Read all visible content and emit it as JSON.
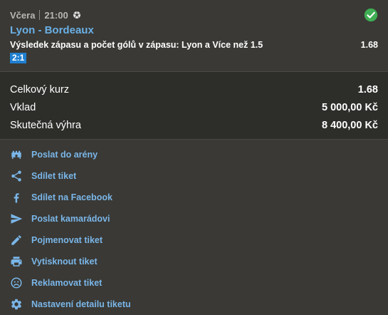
{
  "bet": {
    "day": "Včera",
    "time": "21:00",
    "match": "Lyon - Bordeaux",
    "selection": "Výsledek zápasu a počet gólů v zápasu: Lyon a Více než 1.5",
    "odd": "1.68",
    "score": "2:1"
  },
  "summary": {
    "total_odds_label": "Celkový kurz",
    "total_odds_value": "1.68",
    "stake_label": "Vklad",
    "stake_value": "5 000,00 Kč",
    "win_label": "Skutečná výhra",
    "win_value": "8 400,00 Kč"
  },
  "actions": {
    "arena": "Poslat do arény",
    "share": "Sdílet tiket",
    "facebook": "Sdílet na Facebook",
    "friend": "Poslat kamarádovi",
    "rename": "Pojmenovat tiket",
    "print": "Vytisknout tiket",
    "complain": "Reklamovat tiket",
    "settings": "Nastavení detailu tiketu"
  },
  "colors": {
    "link": "#7ab6e8",
    "win": "#3fae54",
    "score_badge": "#1f7fd1"
  }
}
